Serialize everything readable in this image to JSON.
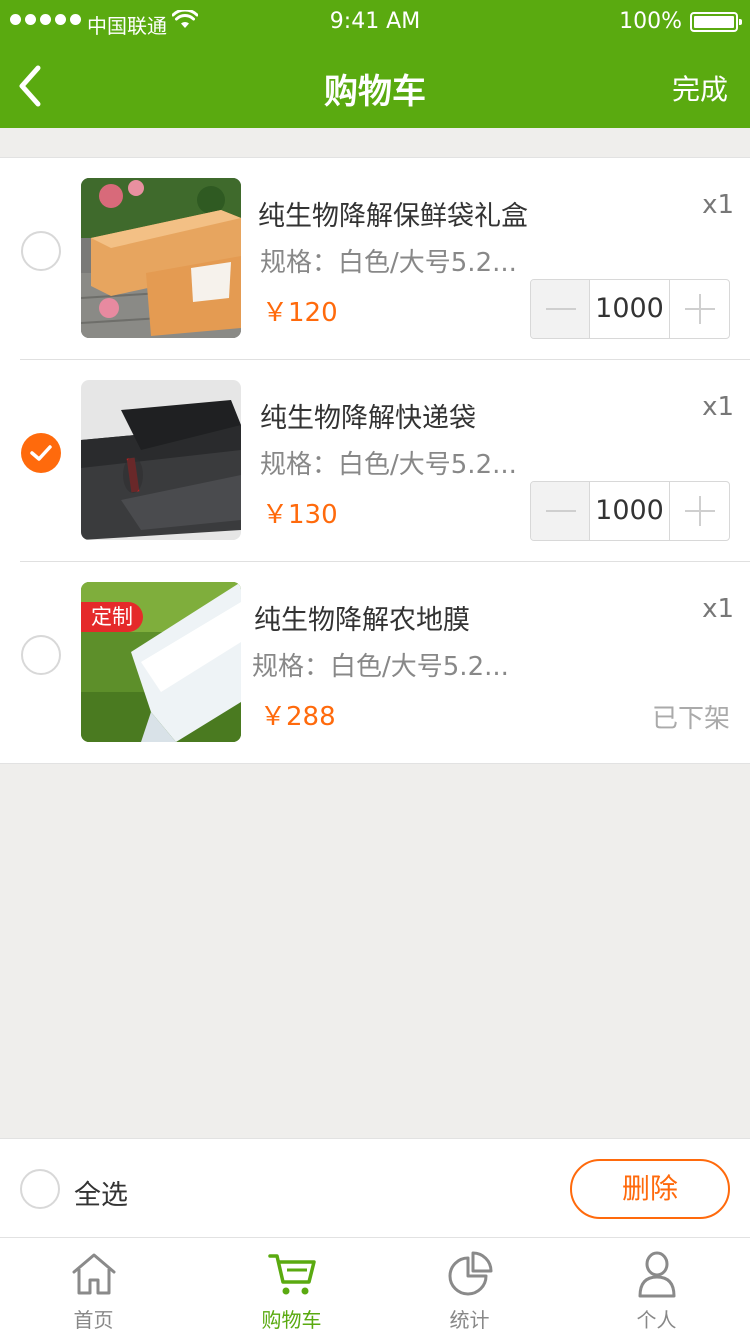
{
  "status_bar": {
    "carrier": "中国联通",
    "time": "9:41 AM",
    "battery": "100%"
  },
  "nav": {
    "title": "购物车",
    "done_label": "完成"
  },
  "colors": {
    "brand_green": "#5aaa10",
    "accent_orange": "#ff6a0c",
    "tag_red": "#e52a2a"
  },
  "items": [
    {
      "name": "纯生物降解保鲜袋礼盒",
      "spec": "规格：白色/大号5.2...",
      "price": "￥120",
      "multiplier": "x1",
      "quantity": "1000",
      "checked": false,
      "image": "gift-box-product-photo"
    },
    {
      "name": "纯生物降解快递袋",
      "spec": "规格：白色/大号5.2...",
      "price": "￥130",
      "multiplier": "x1",
      "quantity": "1000",
      "checked": true,
      "image": "black-express-bag-product-photo"
    },
    {
      "name": "纯生物降解农地膜",
      "spec": "规格：白色/大号5.2...",
      "price": "￥288",
      "multiplier": "x1",
      "tag": "定制",
      "status": "已下架",
      "checked": false,
      "image": "farm-film-on-grass-photo"
    }
  ],
  "action_bar": {
    "select_all_label": "全选",
    "delete_label": "删除"
  },
  "tabs": [
    {
      "label": "首页",
      "icon": "home-icon",
      "active": false
    },
    {
      "label": "购物车",
      "icon": "cart-icon",
      "active": true
    },
    {
      "label": "统计",
      "icon": "pie-chart-icon",
      "active": false
    },
    {
      "label": "个人",
      "icon": "person-icon",
      "active": false
    }
  ]
}
